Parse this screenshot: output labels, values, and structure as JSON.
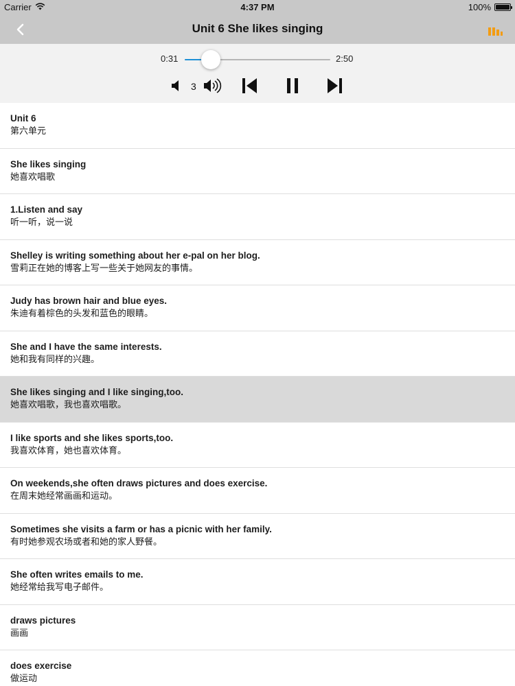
{
  "status_bar": {
    "carrier": "Carrier",
    "time": "4:37 PM",
    "battery": "100%",
    "icons": [
      "wifi-icon",
      "battery-icon"
    ]
  },
  "nav": {
    "title": "Unit 6 She likes singing",
    "back_icon": "chevron-left-icon",
    "list_icon": "bar-chart-icon",
    "accent_color": "#f39c12"
  },
  "player": {
    "current_time": "0:31",
    "total_time": "2:50",
    "progress": 0.18,
    "volume_level": "3",
    "progress_color": "#1e90d6",
    "icons": [
      "volume-down-icon",
      "volume-up-icon",
      "skip-previous-icon",
      "pause-icon",
      "skip-next-icon"
    ]
  },
  "sentences": [
    {
      "en": "Unit 6",
      "zh": "第六单元"
    },
    {
      "en": "She likes singing",
      "zh": "她喜欢唱歌"
    },
    {
      "en": "1.Listen and say",
      "zh": "听一听，说一说"
    },
    {
      "en": "Shelley is writing something about her e-pal on her blog.",
      "zh": "雪莉正在她的博客上写一些关于她网友的事情。"
    },
    {
      "en": "Judy has brown hair and blue eyes.",
      "zh": "朱迪有着棕色的头发和蓝色的眼睛。"
    },
    {
      "en": "She and I have the same interests.",
      "zh": "她和我有同样的兴趣。"
    },
    {
      "en": "She likes singing and I like singing,too.",
      "zh": "她喜欢唱歌，我也喜欢唱歌。"
    },
    {
      "en": "I like sports and she likes sports,too.",
      "zh": "我喜欢体育，她也喜欢体育。"
    },
    {
      "en": "On weekends,she often draws pictures and does exercise.",
      "zh": "在周末她经常画画和运动。"
    },
    {
      "en": "Sometimes she visits a farm or has a picnic with her family.",
      "zh": "有时她参观农场或者和她的家人野餐。"
    },
    {
      "en": "She often writes emails to me.",
      "zh": "她经常给我写电子邮件。"
    },
    {
      "en": "draws pictures",
      "zh": "画画"
    },
    {
      "en": "does exercise",
      "zh": "做运动"
    }
  ],
  "active_index": 6
}
